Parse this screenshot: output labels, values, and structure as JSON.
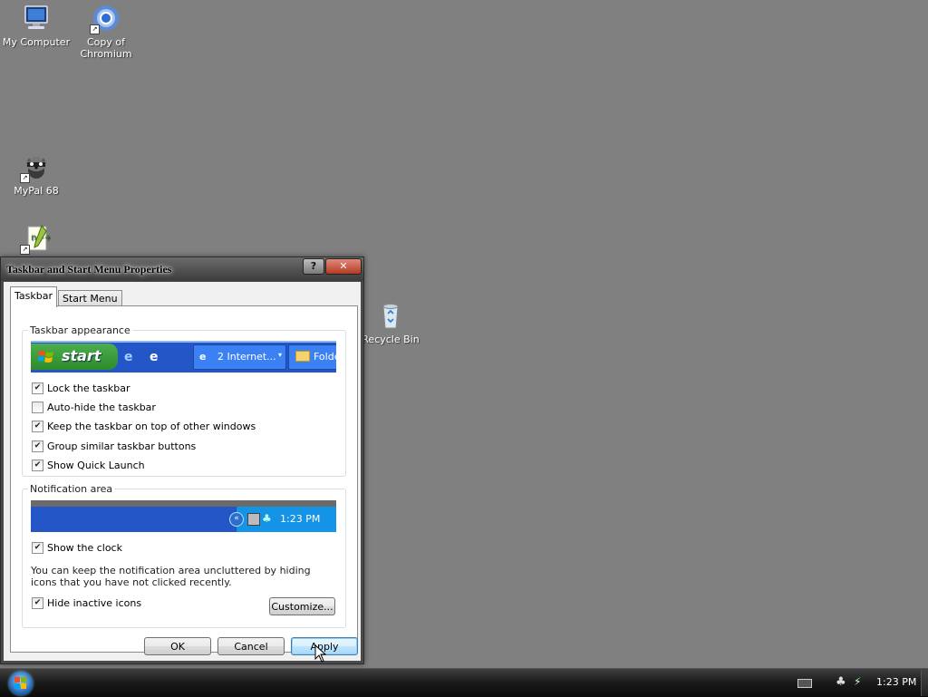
{
  "desktop": {
    "icons": [
      {
        "label": "My Computer"
      },
      {
        "label": "Copy of\nChromium"
      },
      {
        "label": "MyPal 68"
      },
      {
        "label": ""
      },
      {
        "label": "Recycle Bin"
      }
    ]
  },
  "dialog": {
    "title": "Taskbar and Start Menu Properties",
    "help_glyph": "?",
    "close_glyph": "✕",
    "tabs": [
      {
        "label": "Taskbar"
      },
      {
        "label": "Start Menu"
      }
    ],
    "appearance": {
      "group_label": "Taskbar appearance",
      "preview": {
        "start_label": "start",
        "task1": "2 Internet...",
        "task2": "Folde"
      },
      "options": [
        {
          "label": "Lock the taskbar",
          "checked": true
        },
        {
          "label": "Auto-hide the taskbar",
          "checked": false
        },
        {
          "label": "Keep the taskbar on top of other windows",
          "checked": true
        },
        {
          "label": "Group similar taskbar buttons",
          "checked": true
        },
        {
          "label": "Show Quick Launch",
          "checked": true
        }
      ]
    },
    "notification": {
      "group_label": "Notification area",
      "preview_time": "1:23 PM",
      "show_clock_label": "Show the clock",
      "show_clock_checked": true,
      "description": "You can keep the notification area uncluttered by hiding icons that you have not clicked recently.",
      "hide_inactive_label": "Hide inactive icons",
      "hide_inactive_checked": true,
      "customize_label": "Customize..."
    },
    "buttons": {
      "ok": "OK",
      "cancel": "Cancel",
      "apply": "Apply"
    }
  },
  "taskbar": {
    "clock": "1:23 PM"
  },
  "colors": {
    "desktop": "#808080",
    "xp_blue": "#2456c8",
    "xp_green": "#3a9b3a"
  }
}
